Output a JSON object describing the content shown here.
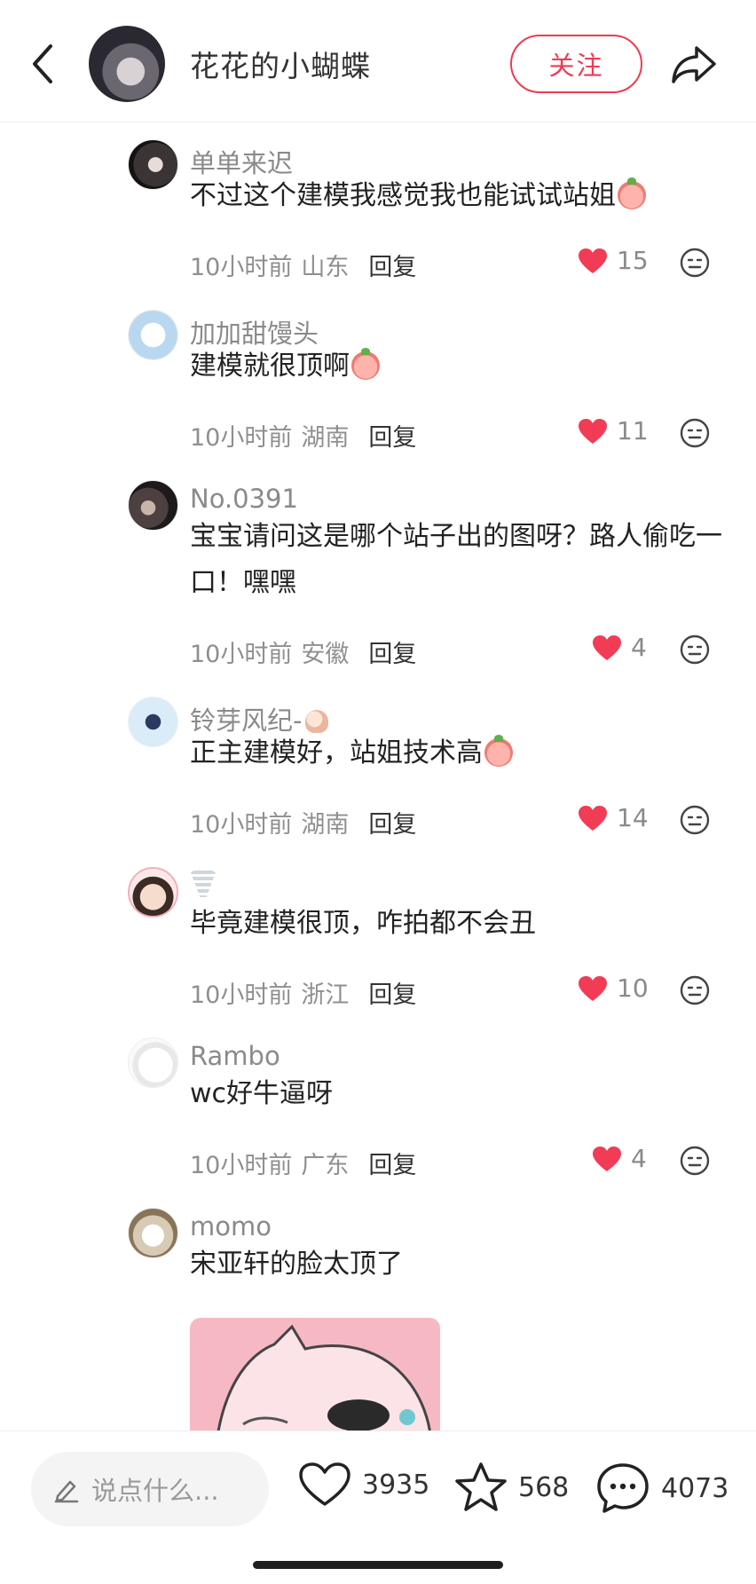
{
  "header": {
    "author_name": "花花的小蝴蝶",
    "follow_label": "关注"
  },
  "comments": [
    {
      "user": "单单来迟",
      "text": "不过这个建模我感觉我也能试试站姐",
      "time": "10小时前",
      "location": "山东",
      "reply": "回复",
      "likes": "15"
    },
    {
      "user": "加加甜馒头",
      "text": "建模就很顶啊",
      "time": "10小时前",
      "location": "湖南",
      "reply": "回复",
      "likes": "11"
    },
    {
      "user": "No.0391",
      "text": "宝宝请问这是哪个站子出的图呀？路人偷吃一口！嘿嘿",
      "time": "10小时前",
      "location": "安徽",
      "reply": "回复",
      "likes": "4"
    },
    {
      "user": "铃芽风纪-",
      "text": "正主建模好，站姐技术高",
      "time": "10小时前",
      "location": "湖南",
      "reply": "回复",
      "likes": "14"
    },
    {
      "user": "",
      "text": "毕竟建模很顶，咋拍都不会丑",
      "time": "10小时前",
      "location": "浙江",
      "reply": "回复",
      "likes": "10"
    },
    {
      "user": "Rambo",
      "text": "wc好牛逼呀",
      "time": "10小时前",
      "location": "广东",
      "reply": "回复",
      "likes": "4"
    },
    {
      "user": "momo",
      "text": "宋亚轩的脸太顶了"
    }
  ],
  "bottom_bar": {
    "input_placeholder": "说点什么...",
    "like_count": "3935",
    "star_count": "568",
    "comment_count": "4073"
  },
  "colors": {
    "accent": "#ef3b52",
    "heart": "#f23b55",
    "muted_text": "#8a8a8a"
  },
  "icons": [
    "back-arrow-icon",
    "share-icon",
    "heart-icon",
    "emoji-face-icon",
    "pencil-icon",
    "star-icon",
    "comment-bubble-icon"
  ]
}
